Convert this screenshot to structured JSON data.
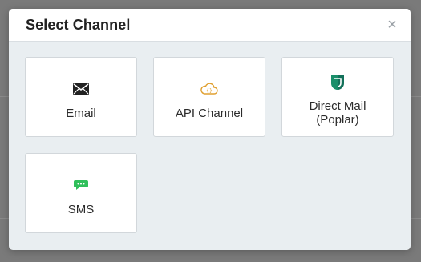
{
  "modal": {
    "title": "Select Channel",
    "close_glyph": "×"
  },
  "channels": [
    {
      "label": "Email",
      "icon": "envelope-icon",
      "color": "#222222"
    },
    {
      "label": "API Channel",
      "icon": "cloud-api-icon",
      "color": "#e0a030"
    },
    {
      "label": "Direct Mail (Poplar)",
      "icon": "poplar-logo-icon",
      "color": "#1a8f6a"
    },
    {
      "label": "SMS",
      "icon": "chat-bubble-icon",
      "color": "#2fbf5a"
    }
  ]
}
